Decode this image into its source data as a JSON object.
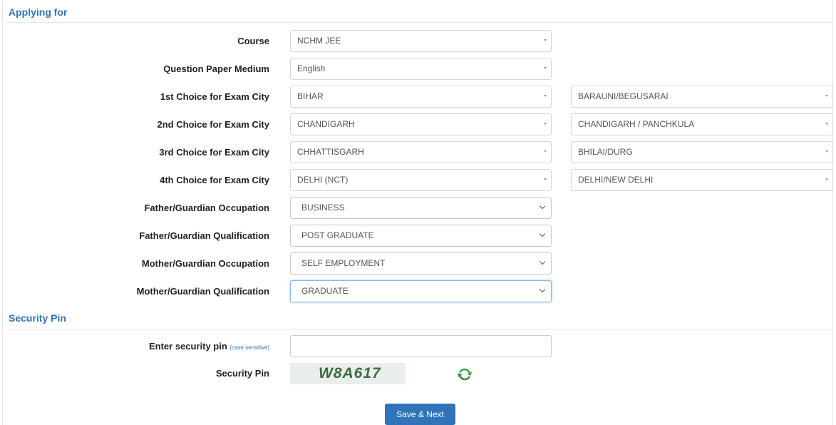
{
  "sections": {
    "applying_for": "Applying for",
    "security_pin": "Security Pin"
  },
  "fields": [
    {
      "label": "Course",
      "value": "NCHM JEE"
    },
    {
      "label": "Question Paper Medium",
      "value": "English"
    },
    {
      "label": "1st Choice for Exam City",
      "state": "BIHAR",
      "city": "BARAUNI/BEGUSARAI"
    },
    {
      "label": "2nd Choice for Exam City",
      "state": "CHANDIGARH",
      "city": "CHANDIGARH / PANCHKULA"
    },
    {
      "label": "3rd Choice for Exam City",
      "state": "CHHATTISGARH",
      "city": "BHILAI/DURG"
    },
    {
      "label": "4th Choice for Exam City",
      "state": "DELHI (NCT)",
      "city": "DELHI/NEW DELHI"
    },
    {
      "label": "Father/Guardian Occupation",
      "value": "BUSINESS"
    },
    {
      "label": "Father/Guardian Qualification",
      "value": "POST GRADUATE"
    },
    {
      "label": "Mother/Guardian Occupation",
      "value": "SELF EMPLOYMENT"
    },
    {
      "label": "Mother/Guardian Qualification",
      "value": "GRADUATE"
    }
  ],
  "security": {
    "enter_label": "Enter security pin",
    "enter_hint": "(case sensitive)",
    "input_value": "",
    "pin_label": "Security Pin",
    "captcha_text": "W8A617"
  },
  "actions": {
    "save_next": "Save & Next"
  },
  "colors": {
    "accent": "#2f73b8",
    "refresh_icon": "#3aa33a"
  },
  "icons": {
    "refresh": "refresh-icon",
    "dropdown": "chevron-down-icon"
  }
}
